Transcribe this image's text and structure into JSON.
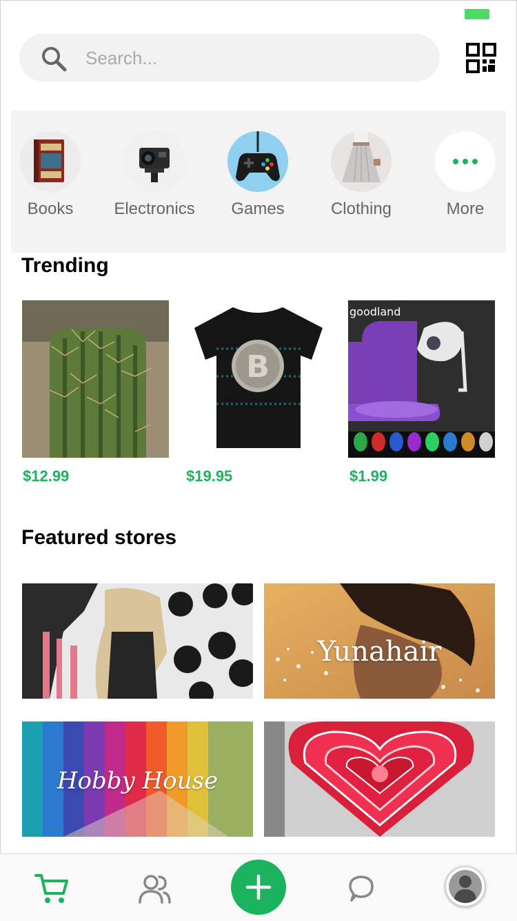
{
  "search": {
    "placeholder": "Search..."
  },
  "categories": [
    {
      "label": "Books",
      "icon": "book-icon"
    },
    {
      "label": "Electronics",
      "icon": "camera-icon"
    },
    {
      "label": "Games",
      "icon": "gamepad-icon"
    },
    {
      "label": "Clothing",
      "icon": "skirt-icon"
    },
    {
      "label": "More",
      "icon": "more-dots-icon"
    }
  ],
  "trending": {
    "title": "Trending",
    "products": [
      {
        "price": "$12.99",
        "image": "cactus-image"
      },
      {
        "price": "$19.95",
        "image": "bitcoin-tshirt-image"
      },
      {
        "price": "$1.99",
        "image": "toilet-light-image",
        "brand_text": "goodland"
      }
    ]
  },
  "featured": {
    "title": "Featured stores",
    "stores": [
      {
        "name": "",
        "image": "fashion-store-image"
      },
      {
        "name": "Yunahair",
        "image": "hair-store-image"
      },
      {
        "name": "Hobby House",
        "image": "hobby-store-image"
      },
      {
        "name": "",
        "image": "neon-heart-store-image"
      }
    ]
  },
  "tabbar": {
    "items": [
      "cart-icon",
      "people-icon",
      "add-icon",
      "chat-icon",
      "profile-avatar"
    ]
  },
  "colors": {
    "accent": "#1bb35e",
    "battery": "#4cd964"
  }
}
